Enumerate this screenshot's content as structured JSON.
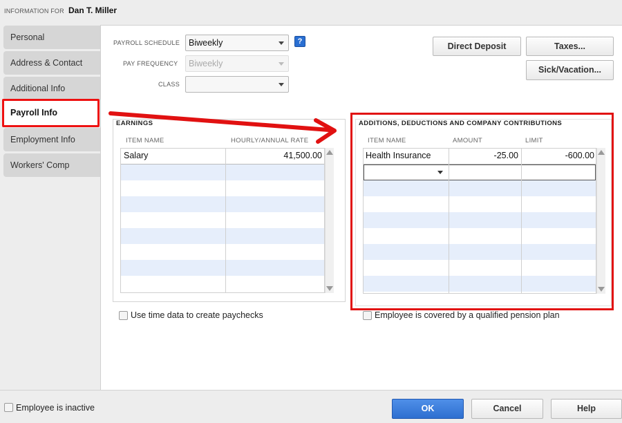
{
  "header": {
    "label": "INFORMATION FOR",
    "employee_name": "Dan T. Miller"
  },
  "sidebar": {
    "tabs": [
      {
        "label": "Personal"
      },
      {
        "label": "Address & Contact"
      },
      {
        "label": "Additional Info"
      },
      {
        "label": "Payroll Info",
        "active": true
      },
      {
        "label": "Employment Info"
      },
      {
        "label": "Workers' Comp"
      }
    ]
  },
  "payroll": {
    "schedule_label": "PAYROLL SCHEDULE",
    "schedule_value": "Biweekly",
    "frequency_label": "PAY FREQUENCY",
    "frequency_value": "Biweekly",
    "class_label": "CLASS",
    "class_value": "",
    "help_glyph": "?"
  },
  "buttons": {
    "direct_deposit": "Direct Deposit",
    "taxes": "Taxes...",
    "sick_vacation": "Sick/Vacation..."
  },
  "earnings": {
    "title": "EARNINGS",
    "columns": [
      "ITEM NAME",
      "HOURLY/ANNUAL RATE"
    ],
    "rows": [
      {
        "item": "Salary",
        "rate": "41,500.00"
      }
    ]
  },
  "additions": {
    "title": "ADDITIONS, DEDUCTIONS AND COMPANY CONTRIBUTIONS",
    "columns": [
      "ITEM NAME",
      "AMOUNT",
      "LIMIT"
    ],
    "rows": [
      {
        "item": "Health Insurance",
        "amount": "-25.00",
        "limit": "-600.00"
      }
    ]
  },
  "checkboxes": {
    "use_time_data": "Use time data to create paychecks",
    "pension_plan": "Employee is covered by a qualified pension plan",
    "inactive": "Employee is inactive"
  },
  "footer": {
    "ok": "OK",
    "cancel": "Cancel",
    "help": "Help"
  },
  "colors": {
    "highlight_red": "#e11111",
    "ok_blue": "#2e6fd0",
    "row_alt": "#e6eefb"
  },
  "icons": [
    "help-icon",
    "dropdown-arrow-icon",
    "red-arrow-annotation",
    "scroll-up-icon",
    "scroll-down-icon"
  ]
}
